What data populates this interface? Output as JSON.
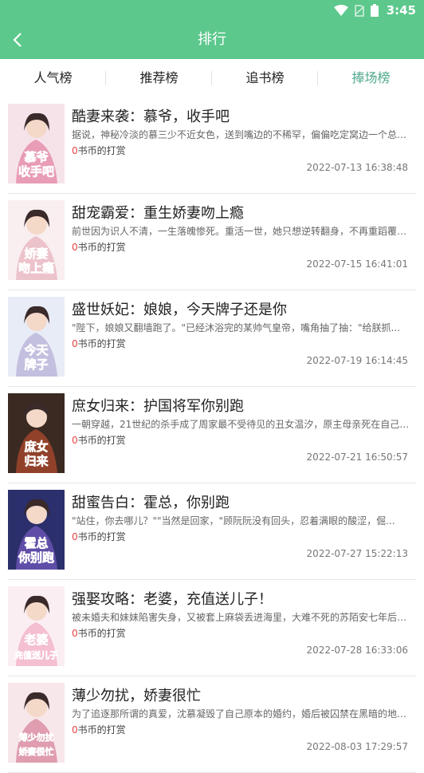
{
  "status_bar": {
    "time": "3:45"
  },
  "header": {
    "title": "排行"
  },
  "tabs": [
    {
      "label": "人气榜"
    },
    {
      "label": "推荐榜"
    },
    {
      "label": "追书榜"
    },
    {
      "label": "捧场榜"
    }
  ],
  "active_tab": "捧场榜",
  "reward_suffix": "书币的打赏",
  "books": [
    {
      "title": "酷妻来袭：慕爷，收手吧",
      "desc": "据说，神秘冷淡的慕三少不近女色，送到嘴边的不稀罕，偏偏吃定窝边一个总想...",
      "reward": "0",
      "date": "2022-07-13 16:38:48",
      "cover_lines": [
        "慕爷",
        "收手吧"
      ],
      "cover_colors": [
        "#f6e3ea",
        "#e58aa9",
        "#d8366b"
      ]
    },
    {
      "title": "甜宠霸爱：重生娇妻吻上瘾",
      "desc": "前世因为识人不清，一生落魄惨死。重活一世，她只想逆转翻身，不再重蹈覆辙...",
      "reward": "0",
      "date": "2022-07-15 16:41:01",
      "cover_lines": [
        "娇妻",
        "吻上瘾"
      ],
      "cover_colors": [
        "#f9eef0",
        "#e8b7c2",
        "#d6285a"
      ]
    },
    {
      "title": "盛世妖妃：娘娘，今天牌子还是你",
      "desc": "\"陛下，娘娘又翻墙跑了。\"已经沐浴完的某帅气皇帝，嘴角抽了抽：\"给朕抓...",
      "reward": "0",
      "date": "2022-07-19 16:14:45",
      "cover_lines": [
        "今天",
        "牌子"
      ],
      "cover_colors": [
        "#e8ecf6",
        "#b9b4da",
        "#5a3d7a"
      ]
    },
    {
      "title": "庶女归来：护国将军你别跑",
      "desc": "一朝穿越，21世纪的杀手成了周家最不受待见的丑女温汐，原主母亲死在自己目...",
      "reward": "0",
      "date": "2022-07-21 16:50:57",
      "cover_lines": [
        "庶女",
        "归来"
      ],
      "cover_colors": [
        "#3a2a22",
        "#a8472d",
        "#f2c35a"
      ]
    },
    {
      "title": "甜蜜告白：霍总，你别跑",
      "desc": "\"站住，你去哪儿？\"\"当然是回家，\"顾阮阮没有回头，忍着满眼的酸涩，倔...",
      "reward": "0",
      "date": "2022-07-27 15:22:13",
      "cover_lines": [
        "霍总",
        "你别跑"
      ],
      "cover_colors": [
        "#2b2f6b",
        "#6d55b8",
        "#ff5fa8"
      ]
    },
    {
      "title": "强娶攻略：老婆，充值送儿子！",
      "desc": "被未婚夫和妹妹陷害失身，又被套上麻袋丢进海里，大难不死的苏陌安七年后携...",
      "reward": "0",
      "date": "2022-07-28 16:33:06",
      "cover_lines": [
        "老婆",
        "充值送儿子"
      ],
      "cover_colors": [
        "#fbeef2",
        "#f2b3c7",
        "#e0224f"
      ]
    },
    {
      "title": "薄少勿扰，娇妻很忙",
      "desc": "为了追逐那所谓的真爱，沈慕凝毁了自己原本的婚约，婚后被囚禁在黑暗的地下...",
      "reward": "0",
      "date": "2022-08-03 17:29:57",
      "cover_lines": [
        "薄少勿扰",
        "娇妻很忙"
      ],
      "cover_colors": [
        "#f7e6ea",
        "#d88ba0",
        "#c8213f"
      ]
    }
  ]
}
